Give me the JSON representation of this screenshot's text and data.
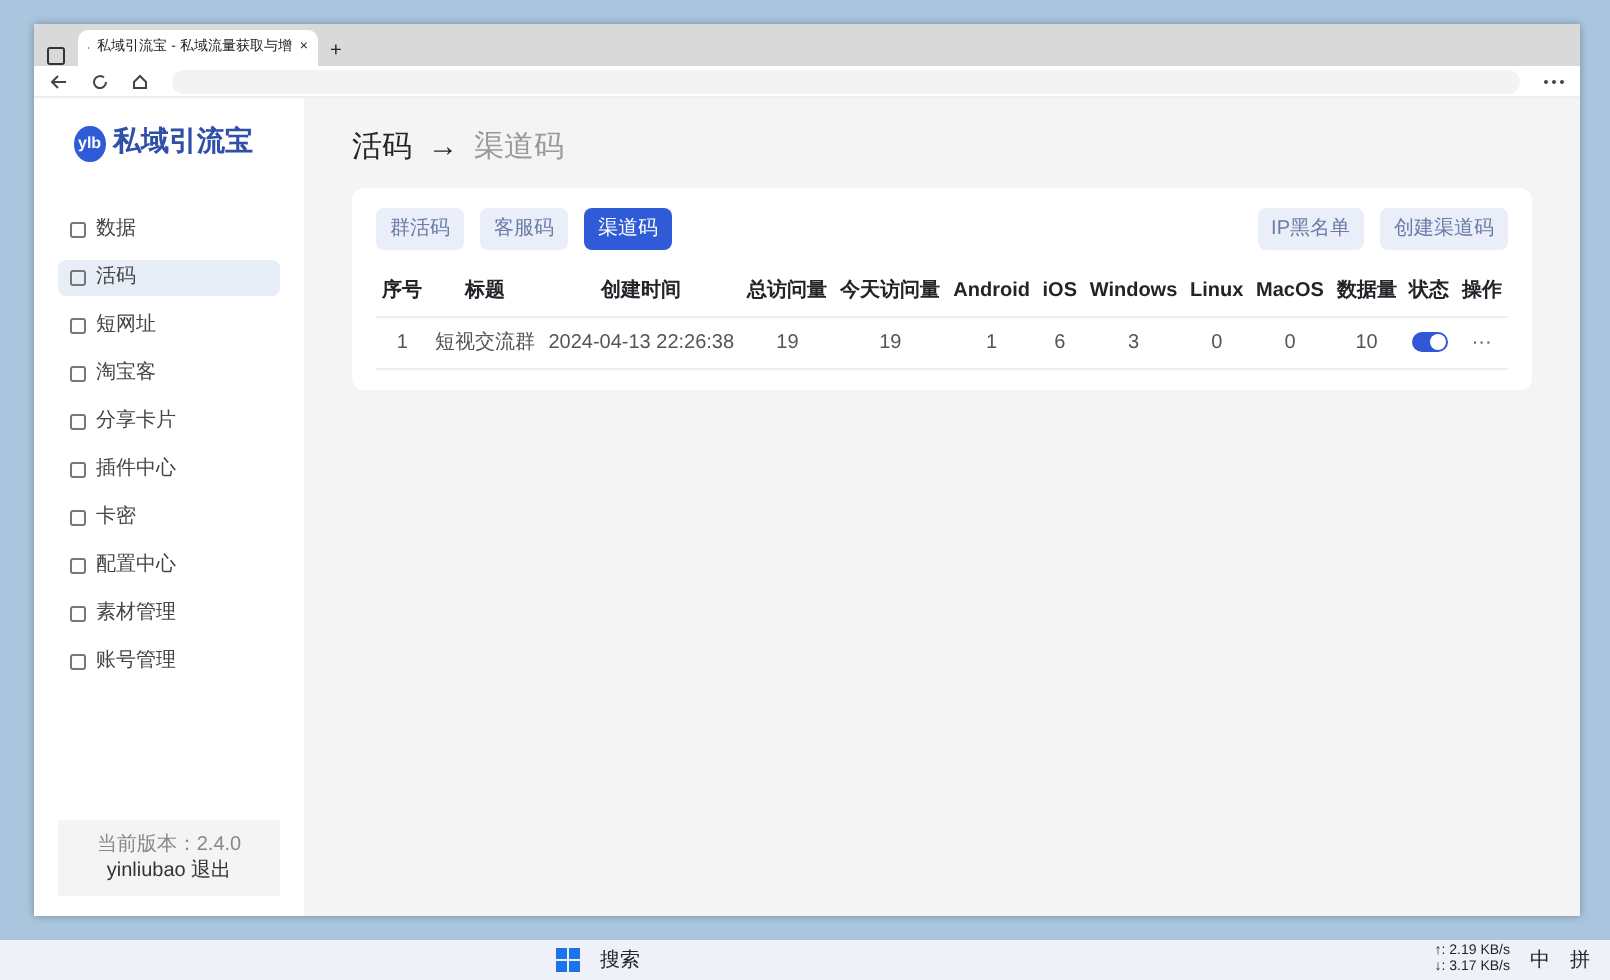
{
  "browser": {
    "tab_title": "私域引流宝 - 私域流量获取与增",
    "tab_close": "×",
    "new_tab": "+"
  },
  "app": {
    "logo_mark": "ylb",
    "logo_text": "私域引流宝",
    "sidebar": {
      "items": [
        {
          "label": "数据",
          "selected": false
        },
        {
          "label": "活码",
          "selected": true
        },
        {
          "label": "短网址",
          "selected": false
        },
        {
          "label": "淘宝客",
          "selected": false
        },
        {
          "label": "分享卡片",
          "selected": false
        },
        {
          "label": "插件中心",
          "selected": false
        },
        {
          "label": "卡密",
          "selected": false
        },
        {
          "label": "配置中心",
          "selected": false
        },
        {
          "label": "素材管理",
          "selected": false
        },
        {
          "label": "账号管理",
          "selected": false
        }
      ],
      "version": "当前版本：2.4.0",
      "user": "yinliubao",
      "logout": "退出"
    },
    "breadcrumb": {
      "parent": "活码",
      "arrow": "→",
      "current": "渠道码"
    },
    "tabs": [
      {
        "label": "群活码",
        "selected": false
      },
      {
        "label": "客服码",
        "selected": false
      },
      {
        "label": "渠道码",
        "selected": true
      }
    ],
    "actions": [
      "IP黑名单",
      "创建渠道码"
    ],
    "table": {
      "columns": [
        "序号",
        "标题",
        "创建时间",
        "总访问量",
        "今天访问量",
        "Android",
        "iOS",
        "Windows",
        "Linux",
        "MacOS",
        "数据量",
        "状态",
        "操作"
      ],
      "rows": [
        {
          "cells": [
            "1",
            "短视交流群",
            "2024-04-13 22:26:38",
            "19",
            "19",
            "1",
            "6",
            "3",
            "0",
            "0",
            "10"
          ],
          "on": true,
          "menu": "···"
        }
      ]
    }
  },
  "taskbar": {
    "search": "搜索",
    "upload": "↑: 2.19 KB/s",
    "download": "↓: 3.17 KB/s",
    "ime": "中",
    "ime_mode": "拼"
  }
}
